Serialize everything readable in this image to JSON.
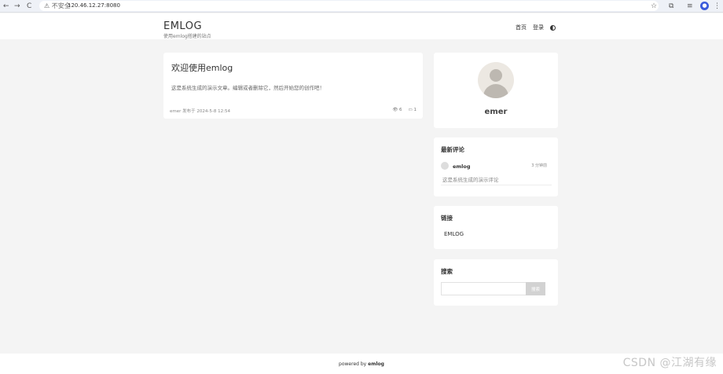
{
  "browser": {
    "back": "←",
    "forward": "→",
    "reload": "C",
    "security_label": "⚠ 不安全",
    "url": "120.46.12.27:8080"
  },
  "header": {
    "site_title": "EMLOG",
    "site_subtitle": "使用emlog搭建的站点",
    "nav": [
      "首页",
      "登录"
    ]
  },
  "article": {
    "title": "欢迎使用emlog",
    "excerpt": "这是系统生成的演示文章。编辑或者删除它，然后开始您的创作吧！",
    "author": "emer",
    "published_label": "发布于",
    "date": "2024-5-8 12:54",
    "views": "6",
    "comments": "1"
  },
  "profile": {
    "name": "emer"
  },
  "widgets": {
    "comments_title": "最新评论",
    "comment": {
      "author": "emlog",
      "time": "3 分钟前",
      "text": "这是系统生成的演示评论"
    },
    "links_title": "链接",
    "link": "EMLOG",
    "search_title": "搜索",
    "search_button": "搜索",
    "search_value": ""
  },
  "footer": {
    "powered_prefix": "powered by",
    "brand": "emlog"
  },
  "watermark": "CSDN @江湖有缘",
  "colors": {
    "page_bg": "#f4f4f4",
    "card_bg": "#ffffff",
    "search_btn_bg": "#d2d2d2"
  }
}
